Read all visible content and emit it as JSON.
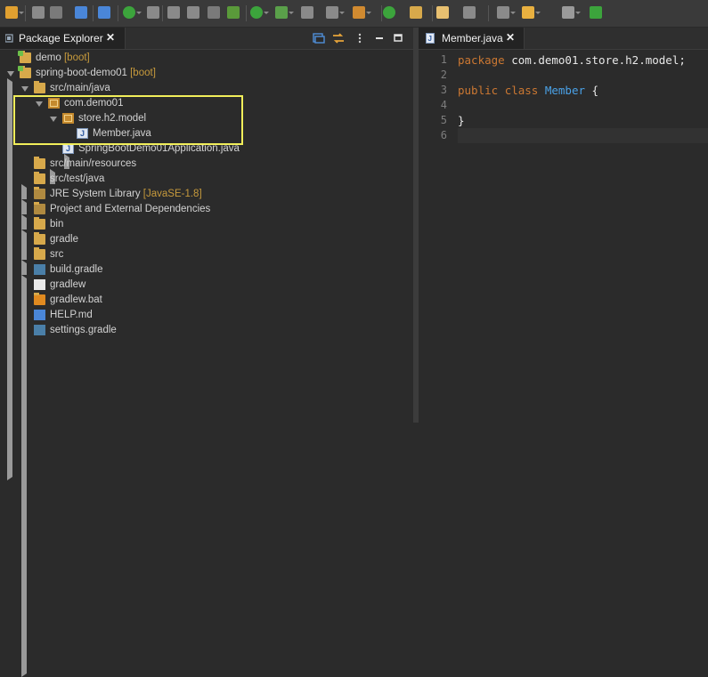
{
  "toolbar": {
    "icons": [
      "new-icon",
      "save-icon",
      "save-all-icon",
      "publish-icon",
      "skip-breakpoints-icon",
      "run-springboot-icon",
      "mark-occurrences-icon",
      "edit-icon",
      "table-icon",
      "show-whitespace-icon",
      "next-annotation-icon",
      "run-icon",
      "debug-icon",
      "stop-icon",
      "external-tools-icon",
      "new-package-icon",
      "refresh-icon",
      "open-type-icon",
      "paint-icon",
      "next-edit-icon",
      "pin-icon",
      "back-icon",
      "forward-icon",
      "open-perspective-icon"
    ]
  },
  "left_panel": {
    "tab_label": "Package Explorer",
    "tab_close": "✕",
    "view_tools": [
      "collapse-all-icon",
      "link-with-editor-icon",
      "view-menu-icon",
      "minimize-icon",
      "maximize-icon"
    ],
    "tree": [
      {
        "label": "demo",
        "decoration": "[boot]",
        "icon": "project-icon",
        "expanded": false
      },
      {
        "label": "spring-boot-demo01",
        "decoration": "[boot]",
        "icon": "project-icon",
        "expanded": true
      },
      {
        "label": "src/main/java",
        "decoration": "",
        "icon": "source-folder-icon",
        "expanded": true
      },
      {
        "label": "com.demo01",
        "decoration": "",
        "icon": "package-icon",
        "expanded": true
      },
      {
        "label": "store.h2.model",
        "decoration": "",
        "icon": "package-icon",
        "expanded": true
      },
      {
        "label": "Member.java",
        "decoration": "",
        "icon": "java-file-icon",
        "expanded": false
      },
      {
        "label": "SpringBootDemo01Application.java",
        "decoration": "",
        "icon": "java-file-icon",
        "expanded": false
      },
      {
        "label": "src/main/resources",
        "decoration": "",
        "icon": "source-folder-icon",
        "expanded": false
      },
      {
        "label": "src/test/java",
        "decoration": "",
        "icon": "source-folder-icon",
        "expanded": false
      },
      {
        "label": "JRE System Library",
        "decoration": "[JavaSE-1.8]",
        "icon": "library-icon",
        "expanded": false
      },
      {
        "label": "Project and External Dependencies",
        "decoration": "",
        "icon": "library-icon",
        "expanded": false
      },
      {
        "label": "bin",
        "decoration": "",
        "icon": "folder-icon",
        "expanded": null
      },
      {
        "label": "gradle",
        "decoration": "",
        "icon": "folder-icon",
        "expanded": false
      },
      {
        "label": "src",
        "decoration": "",
        "icon": "folder-icon",
        "expanded": false
      },
      {
        "label": "build.gradle",
        "decoration": "",
        "icon": "gradle-file-icon",
        "expanded": null
      },
      {
        "label": "gradlew",
        "decoration": "",
        "icon": "text-file-icon",
        "expanded": null
      },
      {
        "label": "gradlew.bat",
        "decoration": "",
        "icon": "script-file-icon",
        "expanded": null
      },
      {
        "label": "HELP.md",
        "decoration": "",
        "icon": "markdown-file-icon",
        "expanded": null
      },
      {
        "label": "settings.gradle",
        "decoration": "",
        "icon": "gradle-file-icon",
        "expanded": null
      }
    ]
  },
  "editor": {
    "tab_label": "Member.java",
    "tab_close": "✕",
    "line_numbers": [
      "1",
      "2",
      "3",
      "4",
      "5",
      "6"
    ],
    "lines": [
      [
        {
          "t": "package",
          "c": "kw"
        },
        {
          "t": " com.demo01.store.h2.model;",
          "c": ""
        }
      ],
      [],
      [
        {
          "t": "public",
          "c": "kw"
        },
        {
          "t": " ",
          "c": ""
        },
        {
          "t": "class",
          "c": "kw"
        },
        {
          "t": " ",
          "c": ""
        },
        {
          "t": "Member",
          "c": "cls"
        },
        {
          "t": " {",
          "c": ""
        }
      ],
      [],
      [
        {
          "t": "}",
          "c": ""
        }
      ],
      []
    ]
  }
}
